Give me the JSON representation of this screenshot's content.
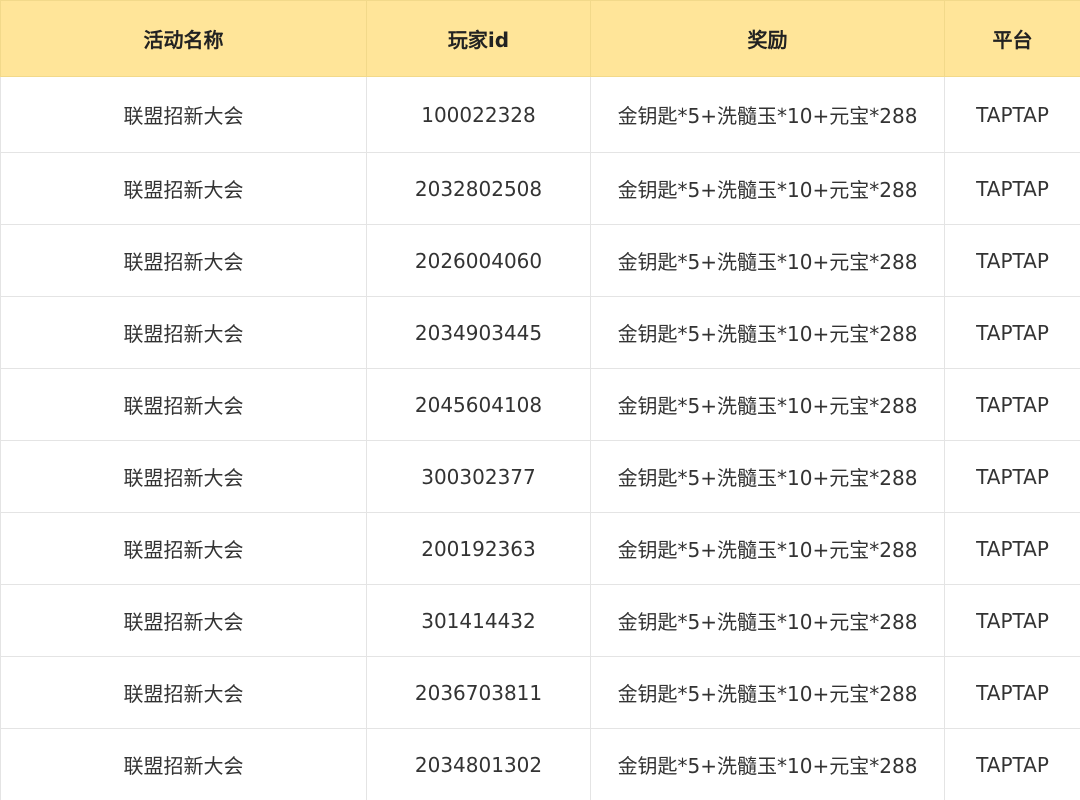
{
  "table": {
    "headers": [
      "活动名称",
      "玩家id",
      "奖励",
      "平台"
    ],
    "rows": [
      [
        "联盟招新大会",
        "100022328",
        "金钥匙*5+洗髓玉*10+元宝*288",
        "TAPTAP"
      ],
      [
        "联盟招新大会",
        "2032802508",
        "金钥匙*5+洗髓玉*10+元宝*288",
        "TAPTAP"
      ],
      [
        "联盟招新大会",
        "2026004060",
        "金钥匙*5+洗髓玉*10+元宝*288",
        "TAPTAP"
      ],
      [
        "联盟招新大会",
        "2034903445",
        "金钥匙*5+洗髓玉*10+元宝*288",
        "TAPTAP"
      ],
      [
        "联盟招新大会",
        "2045604108",
        "金钥匙*5+洗髓玉*10+元宝*288",
        "TAPTAP"
      ],
      [
        "联盟招新大会",
        "300302377",
        "金钥匙*5+洗髓玉*10+元宝*288",
        "TAPTAP"
      ],
      [
        "联盟招新大会",
        "200192363",
        "金钥匙*5+洗髓玉*10+元宝*288",
        "TAPTAP"
      ],
      [
        "联盟招新大会",
        "301414432",
        "金钥匙*5+洗髓玉*10+元宝*288",
        "TAPTAP"
      ],
      [
        "联盟招新大会",
        "2036703811",
        "金钥匙*5+洗髓玉*10+元宝*288",
        "TAPTAP"
      ],
      [
        "联盟招新大会",
        "2034801302",
        "金钥匙*5+洗髓玉*10+元宝*288",
        "TAPTAP"
      ]
    ]
  },
  "colors": {
    "header_bg": "#ffe599",
    "border": "#e4e4e4"
  }
}
